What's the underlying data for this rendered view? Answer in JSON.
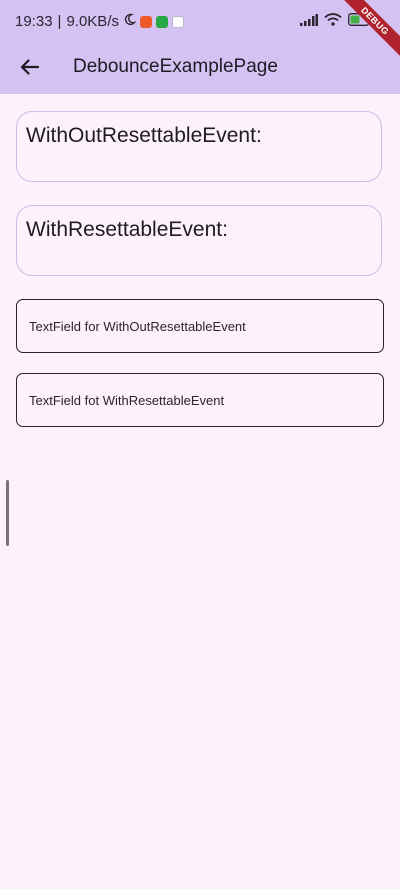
{
  "status_bar": {
    "time": "19:33",
    "separator": "|",
    "speed": "9.0KB/s",
    "icons": [
      "moon-icon",
      "app-notification-icon",
      "app-notification-icon",
      "app-notification-icon",
      "signal-icon",
      "wifi-icon",
      "battery-icon"
    ]
  },
  "app_bar": {
    "title": "DebounceExamplePage",
    "back_icon": "arrow-back-icon",
    "debug_banner": "DEBUG"
  },
  "cards": [
    {
      "label": "WithOutResettableEvent:"
    },
    {
      "label": "WithResettableEvent:"
    }
  ],
  "fields": [
    {
      "label": "TextField for WithOutResettableEvent"
    },
    {
      "label": "TextField fot WithResettableEvent"
    }
  ],
  "colors": {
    "app_bar": "#d3c2f2",
    "background": "#fdf1fb",
    "card_border": "#cdbde6",
    "field_border": "#28232c",
    "debug_banner": "#b0232e"
  }
}
